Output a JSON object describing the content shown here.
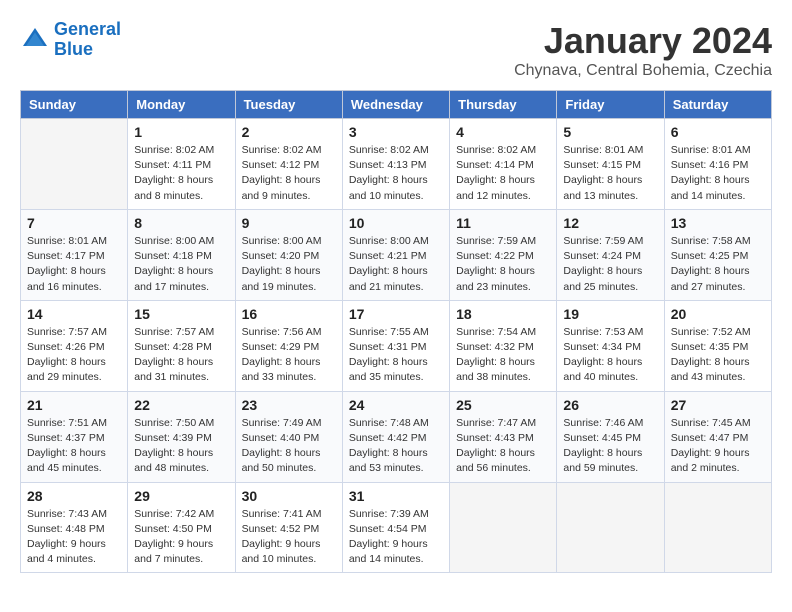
{
  "logo": {
    "line1": "General",
    "line2": "Blue"
  },
  "title": "January 2024",
  "subtitle": "Chynava, Central Bohemia, Czechia",
  "headers": [
    "Sunday",
    "Monday",
    "Tuesday",
    "Wednesday",
    "Thursday",
    "Friday",
    "Saturday"
  ],
  "weeks": [
    [
      {
        "day": "",
        "empty": true
      },
      {
        "day": "1",
        "sunrise": "Sunrise: 8:02 AM",
        "sunset": "Sunset: 4:11 PM",
        "daylight": "Daylight: 8 hours and 8 minutes."
      },
      {
        "day": "2",
        "sunrise": "Sunrise: 8:02 AM",
        "sunset": "Sunset: 4:12 PM",
        "daylight": "Daylight: 8 hours and 9 minutes."
      },
      {
        "day": "3",
        "sunrise": "Sunrise: 8:02 AM",
        "sunset": "Sunset: 4:13 PM",
        "daylight": "Daylight: 8 hours and 10 minutes."
      },
      {
        "day": "4",
        "sunrise": "Sunrise: 8:02 AM",
        "sunset": "Sunset: 4:14 PM",
        "daylight": "Daylight: 8 hours and 12 minutes."
      },
      {
        "day": "5",
        "sunrise": "Sunrise: 8:01 AM",
        "sunset": "Sunset: 4:15 PM",
        "daylight": "Daylight: 8 hours and 13 minutes."
      },
      {
        "day": "6",
        "sunrise": "Sunrise: 8:01 AM",
        "sunset": "Sunset: 4:16 PM",
        "daylight": "Daylight: 8 hours and 14 minutes."
      }
    ],
    [
      {
        "day": "7",
        "sunrise": "Sunrise: 8:01 AM",
        "sunset": "Sunset: 4:17 PM",
        "daylight": "Daylight: 8 hours and 16 minutes."
      },
      {
        "day": "8",
        "sunrise": "Sunrise: 8:00 AM",
        "sunset": "Sunset: 4:18 PM",
        "daylight": "Daylight: 8 hours and 17 minutes."
      },
      {
        "day": "9",
        "sunrise": "Sunrise: 8:00 AM",
        "sunset": "Sunset: 4:20 PM",
        "daylight": "Daylight: 8 hours and 19 minutes."
      },
      {
        "day": "10",
        "sunrise": "Sunrise: 8:00 AM",
        "sunset": "Sunset: 4:21 PM",
        "daylight": "Daylight: 8 hours and 21 minutes."
      },
      {
        "day": "11",
        "sunrise": "Sunrise: 7:59 AM",
        "sunset": "Sunset: 4:22 PM",
        "daylight": "Daylight: 8 hours and 23 minutes."
      },
      {
        "day": "12",
        "sunrise": "Sunrise: 7:59 AM",
        "sunset": "Sunset: 4:24 PM",
        "daylight": "Daylight: 8 hours and 25 minutes."
      },
      {
        "day": "13",
        "sunrise": "Sunrise: 7:58 AM",
        "sunset": "Sunset: 4:25 PM",
        "daylight": "Daylight: 8 hours and 27 minutes."
      }
    ],
    [
      {
        "day": "14",
        "sunrise": "Sunrise: 7:57 AM",
        "sunset": "Sunset: 4:26 PM",
        "daylight": "Daylight: 8 hours and 29 minutes."
      },
      {
        "day": "15",
        "sunrise": "Sunrise: 7:57 AM",
        "sunset": "Sunset: 4:28 PM",
        "daylight": "Daylight: 8 hours and 31 minutes."
      },
      {
        "day": "16",
        "sunrise": "Sunrise: 7:56 AM",
        "sunset": "Sunset: 4:29 PM",
        "daylight": "Daylight: 8 hours and 33 minutes."
      },
      {
        "day": "17",
        "sunrise": "Sunrise: 7:55 AM",
        "sunset": "Sunset: 4:31 PM",
        "daylight": "Daylight: 8 hours and 35 minutes."
      },
      {
        "day": "18",
        "sunrise": "Sunrise: 7:54 AM",
        "sunset": "Sunset: 4:32 PM",
        "daylight": "Daylight: 8 hours and 38 minutes."
      },
      {
        "day": "19",
        "sunrise": "Sunrise: 7:53 AM",
        "sunset": "Sunset: 4:34 PM",
        "daylight": "Daylight: 8 hours and 40 minutes."
      },
      {
        "day": "20",
        "sunrise": "Sunrise: 7:52 AM",
        "sunset": "Sunset: 4:35 PM",
        "daylight": "Daylight: 8 hours and 43 minutes."
      }
    ],
    [
      {
        "day": "21",
        "sunrise": "Sunrise: 7:51 AM",
        "sunset": "Sunset: 4:37 PM",
        "daylight": "Daylight: 8 hours and 45 minutes."
      },
      {
        "day": "22",
        "sunrise": "Sunrise: 7:50 AM",
        "sunset": "Sunset: 4:39 PM",
        "daylight": "Daylight: 8 hours and 48 minutes."
      },
      {
        "day": "23",
        "sunrise": "Sunrise: 7:49 AM",
        "sunset": "Sunset: 4:40 PM",
        "daylight": "Daylight: 8 hours and 50 minutes."
      },
      {
        "day": "24",
        "sunrise": "Sunrise: 7:48 AM",
        "sunset": "Sunset: 4:42 PM",
        "daylight": "Daylight: 8 hours and 53 minutes."
      },
      {
        "day": "25",
        "sunrise": "Sunrise: 7:47 AM",
        "sunset": "Sunset: 4:43 PM",
        "daylight": "Daylight: 8 hours and 56 minutes."
      },
      {
        "day": "26",
        "sunrise": "Sunrise: 7:46 AM",
        "sunset": "Sunset: 4:45 PM",
        "daylight": "Daylight: 8 hours and 59 minutes."
      },
      {
        "day": "27",
        "sunrise": "Sunrise: 7:45 AM",
        "sunset": "Sunset: 4:47 PM",
        "daylight": "Daylight: 9 hours and 2 minutes."
      }
    ],
    [
      {
        "day": "28",
        "sunrise": "Sunrise: 7:43 AM",
        "sunset": "Sunset: 4:48 PM",
        "daylight": "Daylight: 9 hours and 4 minutes."
      },
      {
        "day": "29",
        "sunrise": "Sunrise: 7:42 AM",
        "sunset": "Sunset: 4:50 PM",
        "daylight": "Daylight: 9 hours and 7 minutes."
      },
      {
        "day": "30",
        "sunrise": "Sunrise: 7:41 AM",
        "sunset": "Sunset: 4:52 PM",
        "daylight": "Daylight: 9 hours and 10 minutes."
      },
      {
        "day": "31",
        "sunrise": "Sunrise: 7:39 AM",
        "sunset": "Sunset: 4:54 PM",
        "daylight": "Daylight: 9 hours and 14 minutes."
      },
      {
        "day": "",
        "empty": true
      },
      {
        "day": "",
        "empty": true
      },
      {
        "day": "",
        "empty": true
      }
    ]
  ]
}
